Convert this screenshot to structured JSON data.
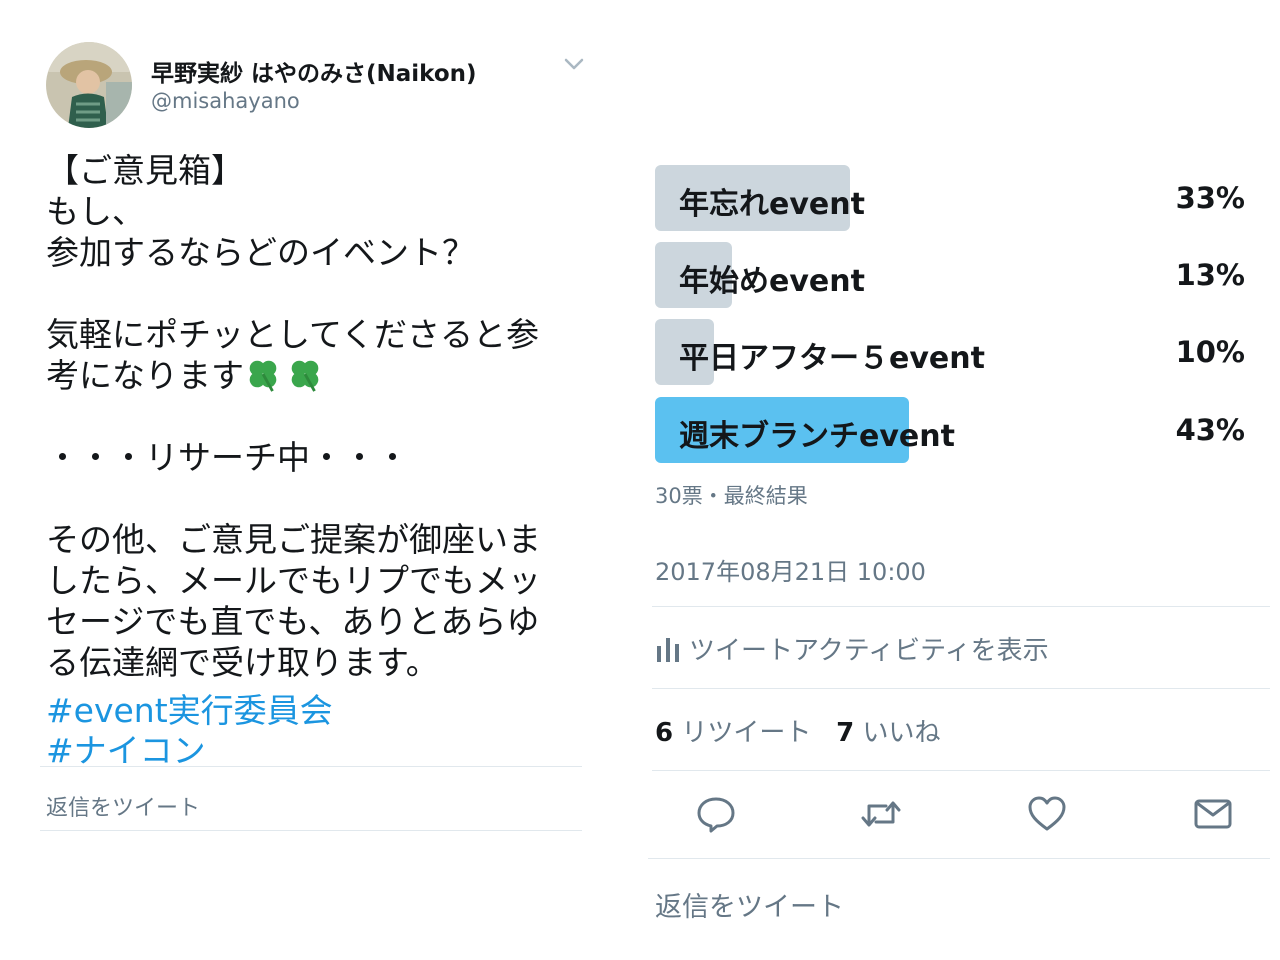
{
  "tweet": {
    "author": {
      "display_name": "早野実紗 はやのみさ(Naikon)",
      "handle": "@misahayano"
    },
    "text": "【ご意見箱】\nもし、\n参加するならどのイベント？\n\n気軽にポチッとしてくださると参\n考になります",
    "emoji": "four-leaf-clover",
    "text_2": "・・・リサーチ中・・・\n\nその他、ご意見ご提案が御座いま\nしたら、メールでもリプでもメッ\nセージでも直でも、ありとあらゆ\nる伝達網で受け取ります。",
    "hashtags": [
      "#event実行委員会",
      "#ナイコン"
    ],
    "reply_prompt": "返信をツイート"
  },
  "poll": {
    "options": [
      {
        "label": "年忘れevent",
        "percent": "33%",
        "value": 33,
        "winner": false
      },
      {
        "label": "年始めevent",
        "percent": "13%",
        "value": 13,
        "winner": false
      },
      {
        "label": "平日アフター５event",
        "percent": "10%",
        "value": 10,
        "winner": false
      },
      {
        "label": "週末ブランチevent",
        "percent": "43%",
        "value": 43,
        "winner": true
      }
    ],
    "meta": "30票・最終結果"
  },
  "details": {
    "timestamp": "2017年08月21日 10:00",
    "activity_label": "ツイートアクティビティを表示",
    "retweet_count": "6",
    "retweet_label": "リツイート",
    "like_count": "7",
    "like_label": "いいね",
    "reply_prompt": "返信をツイート"
  },
  "colors": {
    "poll_bar": "#ccd6dd",
    "poll_bar_winner": "#5bc1f0",
    "link": "#1b95e0",
    "secondary": "#657786",
    "icon": "#657786"
  },
  "icons": [
    "chevron-down-icon",
    "clover-icon",
    "analytics-icon",
    "reply-icon",
    "retweet-icon",
    "like-icon",
    "message-icon"
  ]
}
